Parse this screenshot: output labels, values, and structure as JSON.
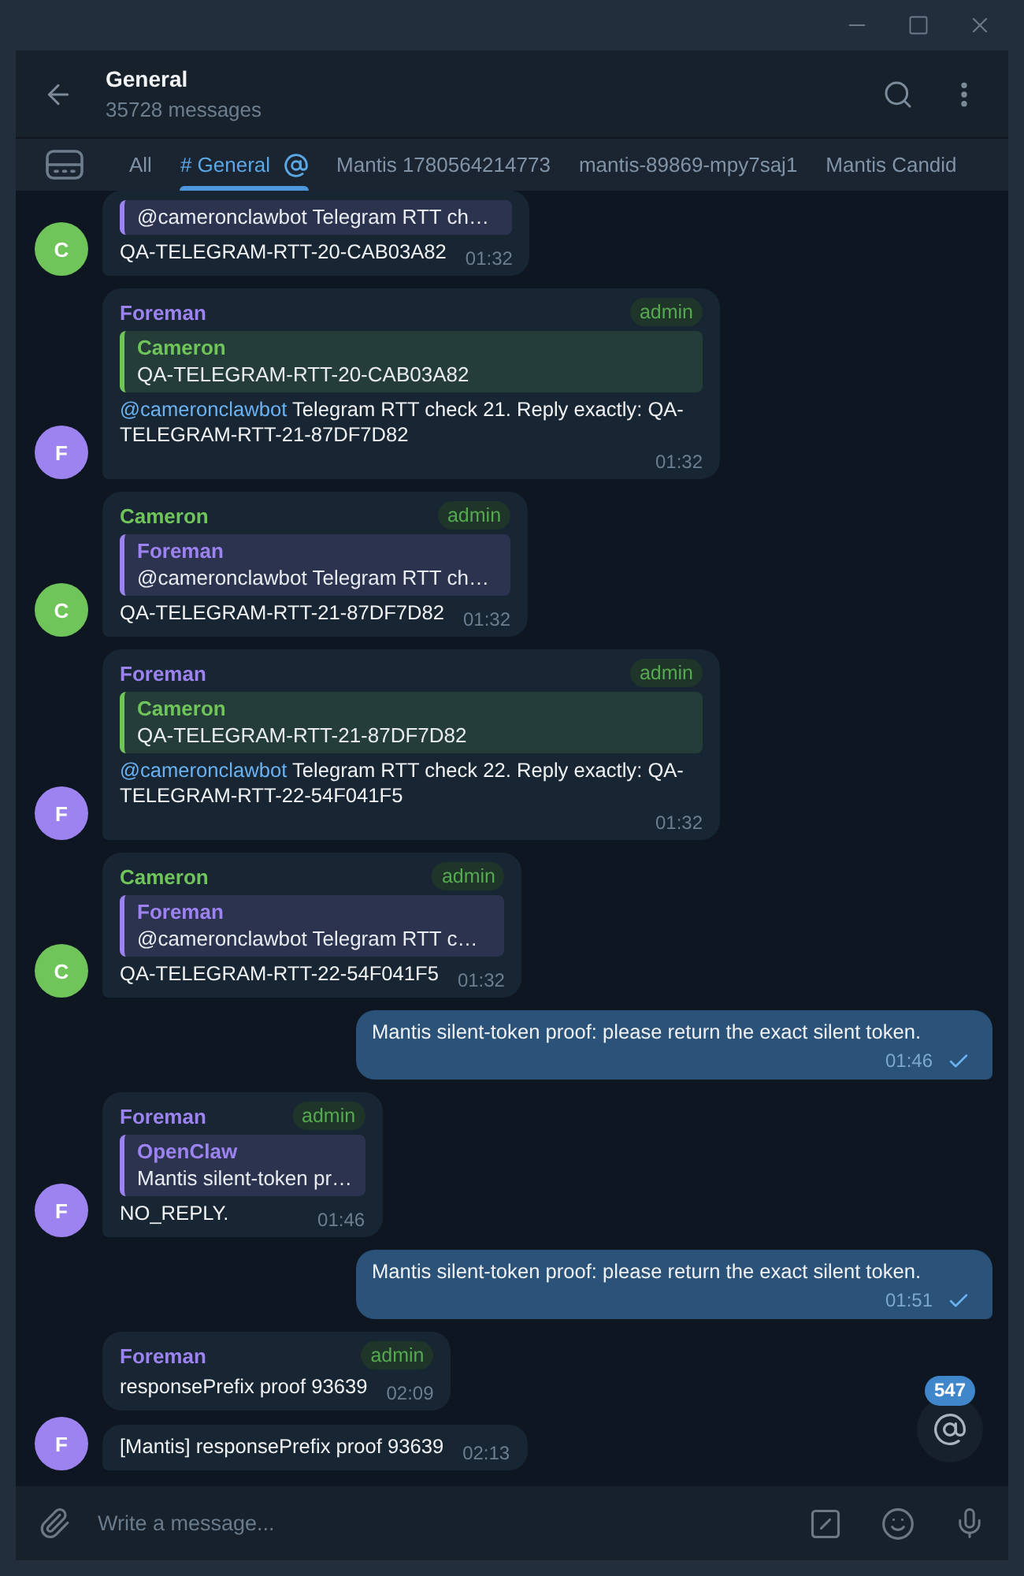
{
  "header": {
    "title": "General",
    "subtitle": "35728 messages"
  },
  "topics": [
    {
      "label": "All",
      "selected": false,
      "mention": false
    },
    {
      "label": "# General",
      "selected": true,
      "mention": true
    },
    {
      "label": "Mantis 1780564214773",
      "selected": false,
      "mention": false
    },
    {
      "label": "mantis-89869-mpy7saj1",
      "selected": false,
      "mention": false
    },
    {
      "label": "Mantis Candid",
      "selected": false,
      "mention": false
    }
  ],
  "messages": [
    {
      "kind": "incoming",
      "color": "#6fc45a",
      "avatar": "C",
      "quote": {
        "color": "#9d83f0",
        "text": "@cameronclawbot Telegram RTT ch…"
      },
      "text": "QA-TELEGRAM-RTT-20-CAB03A82",
      "time": "01:32"
    },
    {
      "kind": "incoming",
      "color": "#9d83f0",
      "avatar": "F",
      "sender": "Foreman",
      "badge": "admin",
      "quote": {
        "author": "Cameron",
        "color": "#6fc45a",
        "text": "QA-TELEGRAM-RTT-20-CAB03A82"
      },
      "mention": "@cameronclawbot",
      "text": "Telegram RTT check 21. Reply exactly: QA-TELEGRAM-RTT-21-87DF7D82",
      "time": "01:32"
    },
    {
      "kind": "incoming",
      "color": "#6fc45a",
      "avatar": "C",
      "sender": "Cameron",
      "badge": "admin",
      "quote": {
        "author": "Foreman",
        "color": "#9d83f0",
        "text": "@cameronclawbot Telegram RTT ch…"
      },
      "text": "QA-TELEGRAM-RTT-21-87DF7D82",
      "time": "01:32"
    },
    {
      "kind": "incoming",
      "color": "#9d83f0",
      "avatar": "F",
      "sender": "Foreman",
      "badge": "admin",
      "quote": {
        "author": "Cameron",
        "color": "#6fc45a",
        "text": "QA-TELEGRAM-RTT-21-87DF7D82"
      },
      "mention": "@cameronclawbot",
      "text": "Telegram RTT check 22. Reply exactly: QA-TELEGRAM-RTT-22-54F041F5",
      "time": "01:32"
    },
    {
      "kind": "incoming",
      "color": "#6fc45a",
      "avatar": "C",
      "sender": "Cameron",
      "badge": "admin",
      "quote": {
        "author": "Foreman",
        "color": "#9d83f0",
        "text": "@cameronclawbot Telegram RTT c…"
      },
      "text": "QA-TELEGRAM-RTT-22-54F041F5",
      "time": "01:32"
    },
    {
      "kind": "outgoing",
      "text": "Mantis silent-token proof: please return the exact silent token.",
      "time": "01:46",
      "read": false
    },
    {
      "kind": "incoming",
      "color": "#9d83f0",
      "avatar": "F",
      "sender": "Foreman",
      "badge": "admin",
      "quote": {
        "author": "OpenClaw",
        "color": "#9d83f0",
        "text": "Mantis silent-token pr…"
      },
      "text": "NO_REPLY.",
      "time": "01:46"
    },
    {
      "kind": "outgoing",
      "text": "Mantis silent-token proof: please return the exact silent token.",
      "time": "01:51",
      "read": false
    },
    {
      "kind": "incoming",
      "color": "#9d83f0",
      "sender": "Foreman",
      "badge": "admin",
      "text": "responsePrefix proof 93639",
      "time": "02:09"
    },
    {
      "kind": "incoming",
      "color": "#9d83f0",
      "avatar": "F",
      "text": "[Mantis] responsePrefix proof 93639",
      "time": "02:13"
    }
  ],
  "mention_button": {
    "count": "547"
  },
  "composer": {
    "placeholder": "Write a message..."
  }
}
